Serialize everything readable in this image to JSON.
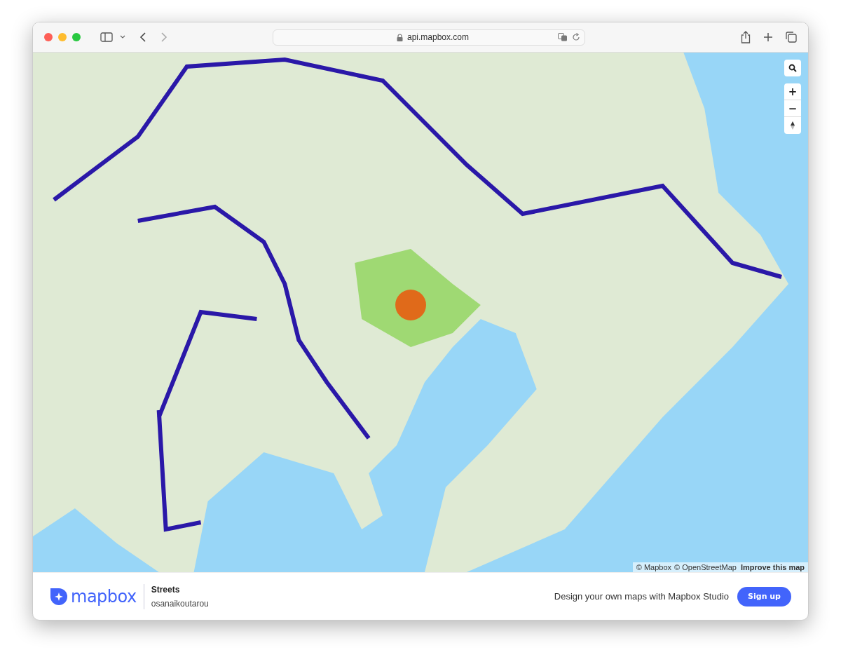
{
  "browser": {
    "url": "api.mapbox.com"
  },
  "map": {
    "attribution": [
      "© Mapbox",
      "© OpenStreetMap"
    ],
    "improve_link": "Improve this map",
    "controls": {
      "zoom_in": "+",
      "zoom_out": "−"
    }
  },
  "footer": {
    "logo_text": "mapbox",
    "style_name": "Streets",
    "owner": "osanaikoutarou",
    "promo": "Design your own maps with Mapbox Studio",
    "signup": "Sign up"
  }
}
